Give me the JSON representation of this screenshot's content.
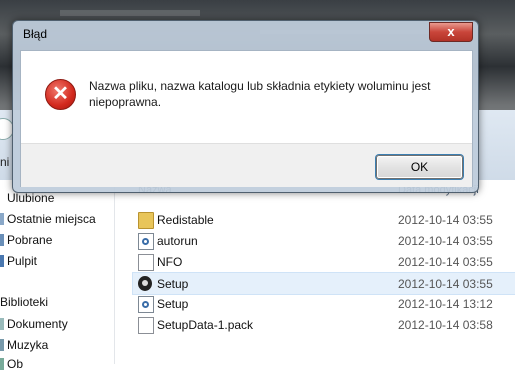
{
  "dialog": {
    "title": "Błąd",
    "close_label": "x",
    "message": "Nazwa pliku, nazwa katalogu lub składnia etykiety woluminu jest niepoprawna.",
    "icon": "error-icon",
    "ok_label": "OK"
  },
  "explorer": {
    "nav_cut_label": "ni",
    "columns": {
      "name": "Nazwa",
      "date": "Data modyfikacji"
    },
    "sidebar": {
      "favorites_label": "Ulubione",
      "favorites": [
        "Ostatnie miejsca",
        "Pobrane",
        "Pulpit"
      ],
      "libraries_label": "Biblioteki",
      "libraries": [
        "Dokumenty",
        "Muzyka",
        "Ob"
      ]
    },
    "files": [
      {
        "name": "Redistable",
        "date": "2012-10-14 03:55",
        "icon": "folder-icon"
      },
      {
        "name": "autorun",
        "date": "2012-10-14 03:55",
        "icon": "settings-file-icon"
      },
      {
        "name": "NFO",
        "date": "2012-10-14 03:55",
        "icon": "document-icon"
      },
      {
        "name": "Setup",
        "date": "2012-10-14 03:55",
        "icon": "radiation-icon",
        "selected": true
      },
      {
        "name": "Setup",
        "date": "2012-10-14 13:12",
        "icon": "settings-file-icon"
      },
      {
        "name": "SetupData-1.pack",
        "date": "2012-10-14 03:58",
        "icon": "document-icon"
      }
    ]
  }
}
